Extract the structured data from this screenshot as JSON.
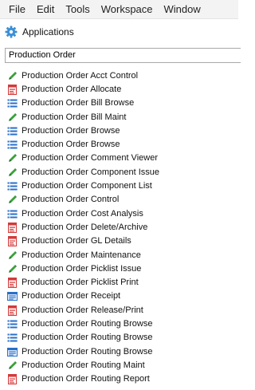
{
  "menubar": {
    "items": [
      {
        "label": "File"
      },
      {
        "label": "Edit"
      },
      {
        "label": "Tools"
      },
      {
        "label": "Workspace"
      },
      {
        "label": "Window"
      }
    ]
  },
  "panel": {
    "icon": "gear-icon",
    "title": "Applications"
  },
  "search": {
    "value": "Production Order"
  },
  "results": [
    {
      "label": "Production Order Acct Control",
      "icon": "pencil"
    },
    {
      "label": "Production Order Allocate",
      "icon": "report"
    },
    {
      "label": "Production Order Bill Browse",
      "icon": "list"
    },
    {
      "label": "Production Order Bill Maint",
      "icon": "pencil"
    },
    {
      "label": "Production Order Browse",
      "icon": "list"
    },
    {
      "label": "Production Order Browse",
      "icon": "list"
    },
    {
      "label": "Production Order Comment Viewer",
      "icon": "pencil"
    },
    {
      "label": "Production Order Component Issue",
      "icon": "pencil"
    },
    {
      "label": "Production Order Component List",
      "icon": "list"
    },
    {
      "label": "Production Order Control",
      "icon": "pencil"
    },
    {
      "label": "Production Order Cost Analysis",
      "icon": "list"
    },
    {
      "label": "Production Order Delete/Archive",
      "icon": "report"
    },
    {
      "label": "Production Order GL Details",
      "icon": "report"
    },
    {
      "label": "Production Order Maintenance",
      "icon": "pencil"
    },
    {
      "label": "Production Order Picklist Issue",
      "icon": "pencil"
    },
    {
      "label": "Production Order Picklist Print",
      "icon": "report"
    },
    {
      "label": "Production Order Receipt",
      "icon": "window"
    },
    {
      "label": "Production Order Release/Print",
      "icon": "report"
    },
    {
      "label": "Production Order Routing Browse",
      "icon": "list"
    },
    {
      "label": "Production Order Routing Browse",
      "icon": "list"
    },
    {
      "label": "Production Order Routing Browse",
      "icon": "window"
    },
    {
      "label": "Production Order Routing Maint",
      "icon": "pencil"
    },
    {
      "label": "Production Order Routing Report",
      "icon": "report"
    }
  ]
}
